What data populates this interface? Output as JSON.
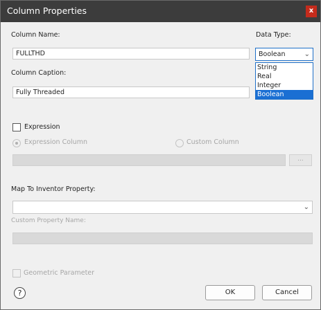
{
  "window": {
    "title": "Column Properties",
    "close_label": "x"
  },
  "column_name": {
    "label": "Column Name:",
    "value": "FULLTHD"
  },
  "data_type": {
    "label": "Data Type:",
    "selected": "Boolean",
    "options": [
      "String",
      "Real",
      "Integer",
      "Boolean"
    ]
  },
  "column_caption": {
    "label": "Column Caption:",
    "value": "Fully Threaded"
  },
  "expression": {
    "checkbox_label": "Expression",
    "expression_column_label": "Expression Column",
    "custom_column_label": "Custom Column",
    "browse_label": "..."
  },
  "inventor": {
    "label": "Map To Inventor Property:",
    "selected": "",
    "custom_property_label": "Custom Property Name:",
    "custom_property_value": ""
  },
  "geometric": {
    "label": "Geometric Parameter"
  },
  "footer": {
    "help_label": "?",
    "ok_label": "OK",
    "cancel_label": "Cancel"
  }
}
